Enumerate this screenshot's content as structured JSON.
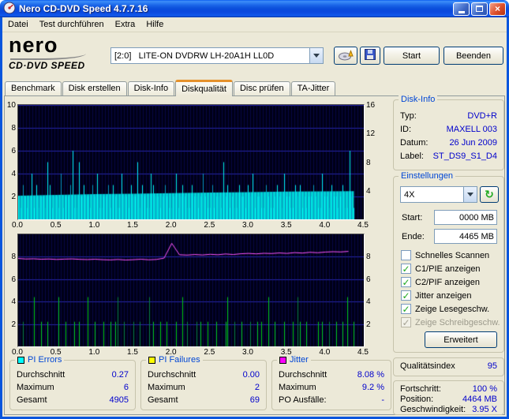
{
  "window": {
    "title": "Nero CD-DVD Speed 4.7.7.16"
  },
  "menu": {
    "items": [
      "Datei",
      "Test durchführen",
      "Extra",
      "Hilfe"
    ]
  },
  "toolbar": {
    "logo_line1": "nero",
    "logo_line2": "CD·DVD SPEED",
    "drive_select": "[2:0]   LITE-ON DVDRW LH-20A1H LL0D",
    "start_label": "Start",
    "quit_label": "Beenden"
  },
  "tabs": [
    {
      "label": "Benchmark"
    },
    {
      "label": "Disk erstellen"
    },
    {
      "label": "Disk-Info"
    },
    {
      "label": "Diskqualität"
    },
    {
      "label": "Disc prüfen"
    },
    {
      "label": "TA-Jitter"
    }
  ],
  "disk_info": {
    "title": "Disk-Info",
    "rows": [
      {
        "label": "Typ:",
        "value": "DVD+R"
      },
      {
        "label": "ID:",
        "value": "MAXELL 003"
      },
      {
        "label": "Datum:",
        "value": "26 Jun 2009"
      },
      {
        "label": "Label:",
        "value": "ST_DS9_S1_D4"
      }
    ]
  },
  "settings": {
    "title": "Einstellungen",
    "speed_value": "4X",
    "refresh_icon": "↻",
    "start_label": "Start:",
    "start_value": "0000 MB",
    "end_label": "Ende:",
    "end_value": "4465 MB",
    "checkboxes": [
      {
        "label": "Schnelles Scannen",
        "checked": false,
        "disabled": false
      },
      {
        "label": "C1/PIE anzeigen",
        "checked": true,
        "disabled": false
      },
      {
        "label": "C2/PIF anzeigen",
        "checked": true,
        "disabled": false
      },
      {
        "label": "Jitter anzeigen",
        "checked": true,
        "disabled": false
      },
      {
        "label": "Zeige Lesegeschw.",
        "checked": true,
        "disabled": false
      },
      {
        "label": "Zeige Schreibgeschw.",
        "checked": true,
        "disabled": true
      }
    ],
    "advanced_label": "Erweitert"
  },
  "quality": {
    "label": "Qualitätsindex",
    "value": "95"
  },
  "progress": {
    "rows": [
      {
        "label": "Fortschritt:",
        "value": "100 %"
      },
      {
        "label": "Position:",
        "value": "4464 MB"
      },
      {
        "label": "Geschwindigkeit:",
        "value": "3.95 X"
      }
    ]
  },
  "stats_boxes": [
    {
      "title": "PI Errors",
      "color": "#00FFFF",
      "rows": [
        {
          "label": "Durchschnitt",
          "value": "0.27"
        },
        {
          "label": "Maximum",
          "value": "6"
        },
        {
          "label": "Gesamt",
          "value": "4905"
        }
      ]
    },
    {
      "title": "PI Failures",
      "color": "#FFFF00",
      "rows": [
        {
          "label": "Durchschnitt",
          "value": "0.00"
        },
        {
          "label": "Maximum",
          "value": "2"
        },
        {
          "label": "Gesamt",
          "value": "69"
        }
      ]
    },
    {
      "title": "Jitter",
      "color": "#FF00FF",
      "rows": [
        {
          "label": "Durchschnitt",
          "value": "8.08 %"
        },
        {
          "label": "Maximum",
          "value": "9.2 %"
        },
        {
          "label": "PO Ausfälle:",
          "value": "-"
        }
      ]
    }
  ],
  "chart_data": [
    {
      "type": "mixed",
      "name": "PI Errors / Lesegeschwindigkeit",
      "x_min": 0,
      "x_max": 4.5,
      "x_ticks": [
        "0.0",
        "0.5",
        "1.0",
        "1.5",
        "2.0",
        "2.5",
        "3.0",
        "3.5",
        "4.0",
        "4.5"
      ],
      "y_left": {
        "max": 10,
        "ticks": [
          10,
          8,
          6,
          4,
          2
        ]
      },
      "y_right": {
        "max": 16,
        "ticks": [
          16,
          12,
          8,
          4
        ]
      },
      "bg": "#000016",
      "series": [
        {
          "name": "Lesegeschwindigkeit",
          "type": "area",
          "axis_max": 16,
          "color": "#00D4D4",
          "x": [
            0,
            0.5,
            1,
            1.5,
            2,
            2.5,
            3,
            3.5,
            4,
            4.37
          ],
          "values": [
            3.3,
            3.42,
            3.52,
            3.6,
            3.68,
            3.75,
            3.82,
            3.88,
            3.93,
            3.95
          ]
        },
        {
          "name": "PI Errors",
          "type": "spikes",
          "axis_max": 10,
          "color": "#00F0F0",
          "x_end": 4.37,
          "profile": [
            "2132124131",
            "2215312214",
            "1223611523",
            "2213241122",
            "3132114221",
            "3225132114",
            "3221232112",
            "4123211322",
            "1242113122",
            "1523121132",
            "2132412211",
            "3211232142",
            "2113231212",
            "2321142213",
            "2212311621"
          ]
        }
      ]
    },
    {
      "type": "mixed",
      "name": "PI Failures / Jitter",
      "x_min": 0,
      "x_max": 4.5,
      "x_ticks": [
        "0.0",
        "0.5",
        "1.0",
        "1.5",
        "2.0",
        "2.5",
        "3.0",
        "3.5",
        "4.0",
        "4.5"
      ],
      "y_left": {
        "max": 10,
        "ticks": [
          8,
          6,
          4,
          2
        ]
      },
      "y_right": {
        "max": 10,
        "ticks": [
          8,
          6,
          4,
          2
        ]
      },
      "bg": "#000016",
      "series": [
        {
          "name": "PI Failures",
          "type": "spikes",
          "axis_max": 10,
          "color": "#00C818",
          "x_end": 4.37,
          "display_scale": 2.2,
          "profile": [
            "0010000200",
            "1001000020",
            "0100010100",
            "0200100010",
            "0101200100",
            "0100100020",
            "1001001000",
            "1002010001",
            "0100100010",
            "0012001001",
            "0001001010",
            "0200100010",
            "0010210010",
            "0001010010",
            "0100102001"
          ]
        },
        {
          "name": "Jitter",
          "type": "line",
          "axis_max": 10,
          "color": "#FF54FF",
          "x_step": 0.1,
          "values": [
            7.85,
            7.8,
            7.82,
            7.78,
            7.8,
            7.76,
            7.79,
            7.81,
            7.77,
            7.75,
            7.78,
            7.74,
            7.72,
            7.76,
            7.71,
            7.74,
            7.78,
            7.73,
            7.76,
            7.88,
            9.2,
            8.18,
            8.15,
            8.2,
            8.16,
            8.22,
            8.18,
            8.25,
            8.2,
            8.27,
            8.3,
            8.26,
            8.31,
            8.29,
            8.34,
            8.3,
            8.37,
            8.33,
            8.4,
            8.36,
            8.42,
            8.45,
            8.43,
            8.48
          ]
        }
      ]
    }
  ]
}
